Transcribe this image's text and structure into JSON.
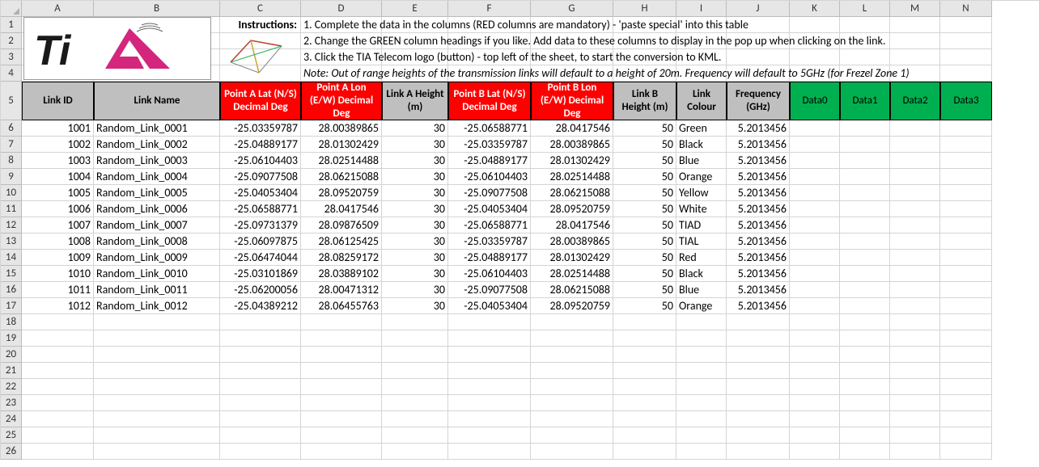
{
  "columns": [
    "A",
    "B",
    "C",
    "D",
    "E",
    "F",
    "G",
    "H",
    "I",
    "J",
    "K",
    "L",
    "M",
    "N"
  ],
  "row_numbers": [
    1,
    2,
    3,
    4,
    5,
    6,
    7,
    8,
    9,
    10,
    11,
    12,
    13,
    14,
    15,
    16,
    17,
    18,
    19,
    20,
    21,
    22,
    23,
    24,
    25,
    26
  ],
  "instructions_label": "Instructions:",
  "instruction1": "1. Complete the data in the columns (RED columns are mandatory) - 'paste special' into this table",
  "instruction2": "2. Change the GREEN column headings if you like. Add data to these columns to display in the pop up when clicking on the link.",
  "instruction3": "3. Click the TIA Telecom logo (button) - top left of the sheet, to start the conversion to KML.",
  "note": "Note: Out of range heights of the transmission links will default to a height of 20m. Frequency will default to 5GHz (for Frezel Zone 1)",
  "headers": {
    "A": "Link ID",
    "B": "Link Name",
    "C": "Point A Lat (N/S) Decimal Deg",
    "D": "Point A Lon (E/W) Decimal Deg",
    "E": "Link A Height (m)",
    "F": "Point B Lat (N/S) Decimal Deg",
    "G": "Point B Lon (E/W) Decimal Deg",
    "H": "Link B Height (m)",
    "I": "Link Colour",
    "J": "Frequency (GHz)",
    "K": "Data0",
    "L": "Data1",
    "M": "Data2",
    "N": "Data3"
  },
  "header_styles": {
    "A": "gray",
    "B": "gray",
    "C": "red",
    "D": "red",
    "E": "gray",
    "F": "red",
    "G": "red",
    "H": "gray",
    "I": "gray",
    "J": "gray",
    "K": "green",
    "L": "green",
    "M": "green",
    "N": "green"
  },
  "data_rows": [
    {
      "A": "1001",
      "B": "Random_Link_0001",
      "C": "-25.03359787",
      "D": "28.00389865",
      "E": "30",
      "F": "-25.06588771",
      "G": "28.0417546",
      "H": "50",
      "I": "Green",
      "J": "5.2013456"
    },
    {
      "A": "1002",
      "B": "Random_Link_0002",
      "C": "-25.04889177",
      "D": "28.01302429",
      "E": "30",
      "F": "-25.03359787",
      "G": "28.00389865",
      "H": "50",
      "I": "Black",
      "J": "5.2013456"
    },
    {
      "A": "1003",
      "B": "Random_Link_0003",
      "C": "-25.06104403",
      "D": "28.02514488",
      "E": "30",
      "F": "-25.04889177",
      "G": "28.01302429",
      "H": "50",
      "I": "Blue",
      "J": "5.2013456"
    },
    {
      "A": "1004",
      "B": "Random_Link_0004",
      "C": "-25.09077508",
      "D": "28.06215088",
      "E": "30",
      "F": "-25.06104403",
      "G": "28.02514488",
      "H": "50",
      "I": "Orange",
      "J": "5.2013456"
    },
    {
      "A": "1005",
      "B": "Random_Link_0005",
      "C": "-25.04053404",
      "D": "28.09520759",
      "E": "30",
      "F": "-25.09077508",
      "G": "28.06215088",
      "H": "50",
      "I": "Yellow",
      "J": "5.2013456"
    },
    {
      "A": "1006",
      "B": "Random_Link_0006",
      "C": "-25.06588771",
      "D": "28.0417546",
      "E": "30",
      "F": "-25.04053404",
      "G": "28.09520759",
      "H": "50",
      "I": "White",
      "J": "5.2013456"
    },
    {
      "A": "1007",
      "B": "Random_Link_0007",
      "C": "-25.09731379",
      "D": "28.09876509",
      "E": "30",
      "F": "-25.06588771",
      "G": "28.0417546",
      "H": "50",
      "I": "TIAD",
      "J": "5.2013456"
    },
    {
      "A": "1008",
      "B": "Random_Link_0008",
      "C": "-25.06097875",
      "D": "28.06125425",
      "E": "30",
      "F": "-25.03359787",
      "G": "28.00389865",
      "H": "50",
      "I": "TIAL",
      "J": "5.2013456"
    },
    {
      "A": "1009",
      "B": "Random_Link_0009",
      "C": "-25.06474044",
      "D": "28.08259172",
      "E": "30",
      "F": "-25.04889177",
      "G": "28.01302429",
      "H": "50",
      "I": "Red",
      "J": "5.2013456"
    },
    {
      "A": "1010",
      "B": "Random_Link_0010",
      "C": "-25.03101869",
      "D": "28.03889102",
      "E": "30",
      "F": "-25.06104403",
      "G": "28.02514488",
      "H": "50",
      "I": "Black",
      "J": "5.2013456"
    },
    {
      "A": "1011",
      "B": "Random_Link_0011",
      "C": "-25.06200056",
      "D": "28.00471312",
      "E": "30",
      "F": "-25.09077508",
      "G": "28.06215088",
      "H": "50",
      "I": "Blue",
      "J": "5.2013456"
    },
    {
      "A": "1012",
      "B": "Random_Link_0012",
      "C": "-25.04389212",
      "D": "28.06455763",
      "E": "30",
      "F": "-25.04053404",
      "G": "28.09520759",
      "H": "50",
      "I": "Orange",
      "J": "5.2013456"
    }
  ],
  "chart_data": {
    "type": "table",
    "title": "Transmission Links",
    "columns": [
      "Link ID",
      "Link Name",
      "Point A Lat",
      "Point A Lon",
      "Link A Height (m)",
      "Point B Lat",
      "Point B Lon",
      "Link B Height (m)",
      "Link Colour",
      "Frequency (GHz)"
    ],
    "rows": [
      [
        1001,
        "Random_Link_0001",
        -25.03359787,
        28.00389865,
        30,
        -25.06588771,
        28.0417546,
        50,
        "Green",
        5.2013456
      ],
      [
        1002,
        "Random_Link_0002",
        -25.04889177,
        28.01302429,
        30,
        -25.03359787,
        28.00389865,
        50,
        "Black",
        5.2013456
      ],
      [
        1003,
        "Random_Link_0003",
        -25.06104403,
        28.02514488,
        30,
        -25.04889177,
        28.01302429,
        50,
        "Blue",
        5.2013456
      ],
      [
        1004,
        "Random_Link_0004",
        -25.09077508,
        28.06215088,
        30,
        -25.06104403,
        28.02514488,
        50,
        "Orange",
        5.2013456
      ],
      [
        1005,
        "Random_Link_0005",
        -25.04053404,
        28.09520759,
        30,
        -25.09077508,
        28.06215088,
        50,
        "Yellow",
        5.2013456
      ],
      [
        1006,
        "Random_Link_0006",
        -25.06588771,
        28.0417546,
        30,
        -25.04053404,
        28.09520759,
        50,
        "White",
        5.2013456
      ],
      [
        1007,
        "Random_Link_0007",
        -25.09731379,
        28.09876509,
        30,
        -25.06588771,
        28.0417546,
        50,
        "TIAD",
        5.2013456
      ],
      [
        1008,
        "Random_Link_0008",
        -25.06097875,
        28.06125425,
        30,
        -25.03359787,
        28.00389865,
        50,
        "TIAL",
        5.2013456
      ],
      [
        1009,
        "Random_Link_0009",
        -25.06474044,
        28.08259172,
        30,
        -25.04889177,
        28.01302429,
        50,
        "Red",
        5.2013456
      ],
      [
        1010,
        "Random_Link_0010",
        -25.03101869,
        28.03889102,
        30,
        -25.06104403,
        28.02514488,
        50,
        "Black",
        5.2013456
      ],
      [
        1011,
        "Random_Link_0011",
        -25.06200056,
        28.00471312,
        30,
        -25.09077508,
        28.06215088,
        50,
        "Blue",
        5.2013456
      ],
      [
        1012,
        "Random_Link_0012",
        -25.04389212,
        28.06455763,
        30,
        -25.04053404,
        28.09520759,
        50,
        "Orange",
        5.2013456
      ]
    ]
  }
}
